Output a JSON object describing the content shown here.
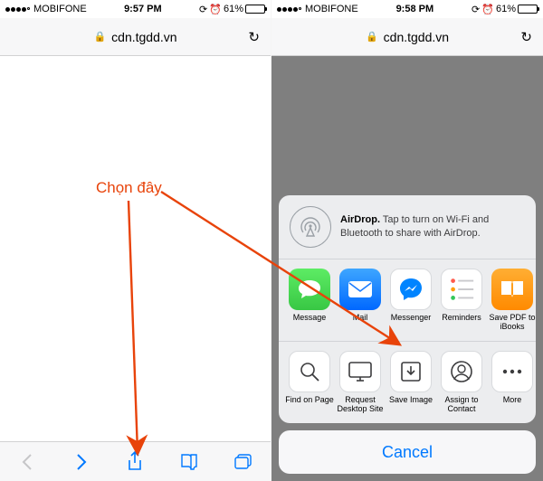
{
  "annotation": {
    "label": "Chọn đây"
  },
  "left": {
    "status": {
      "carrier": "MOBIFONE",
      "time": "9:57 PM",
      "battery_pct": "61%"
    },
    "address": {
      "host": "cdn.tgdd.vn"
    }
  },
  "right": {
    "status": {
      "carrier": "MOBIFONE",
      "time": "9:58 PM",
      "battery_pct": "61%"
    },
    "address": {
      "host": "cdn.tgdd.vn"
    },
    "sheet": {
      "airdrop": {
        "title": "AirDrop.",
        "body": "Tap to turn on Wi-Fi and Bluetooth to share with AirDrop."
      },
      "apps": {
        "message": "Message",
        "mail": "Mail",
        "messenger": "Messenger",
        "reminders": "Reminders",
        "savepdf": "Save PDF to iBooks"
      },
      "actions": {
        "find": "Find on Page",
        "desktop": "Request Desktop Site",
        "save": "Save Image",
        "assign": "Assign to Contact",
        "more": "More"
      },
      "cancel": "Cancel"
    }
  }
}
